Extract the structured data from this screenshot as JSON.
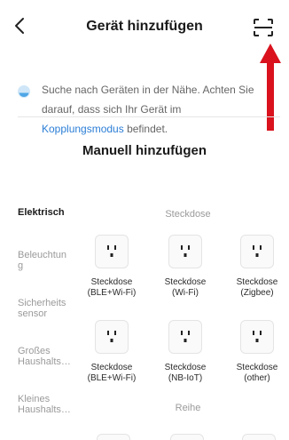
{
  "header": {
    "title": "Gerät hinzufügen"
  },
  "info": {
    "text_before": "Suche nach Geräten in der Nähe. Achten Sie darauf, dass sich Ihr Gerät im ",
    "link": "Kopplungsmodus",
    "text_after": " befindet."
  },
  "section": {
    "title": "Manuell hinzufügen"
  },
  "categories": [
    {
      "label": "Elektrisch",
      "active": true
    },
    {
      "label": "Beleuchtung",
      "active": false
    },
    {
      "label": "Sicherheitssensor",
      "active": false
    },
    {
      "label": "Großes Haushalts…",
      "active": false
    },
    {
      "label": "Kleines Haushalts…",
      "active": false
    }
  ],
  "category_display": {
    "beleuchtung": [
      "Beleuchtun",
      "g"
    ],
    "sicherheit": [
      "Sicherheits",
      "sensor"
    ],
    "gross": [
      "Großes",
      "Haushalts…"
    ],
    "klein": [
      "Kleines",
      "Haushalts…"
    ]
  },
  "groups": {
    "steckdose": "Steckdose",
    "reihe": "Reihe"
  },
  "devices": [
    {
      "line1": "Steckdose",
      "line2": "(BLE+Wi-Fi)"
    },
    {
      "line1": "Steckdose",
      "line2": "(Wi-Fi)"
    },
    {
      "line1": "Steckdose",
      "line2": "(Zigbee)"
    },
    {
      "line1": "Steckdose",
      "line2": "(BLE+Wi-Fi)"
    },
    {
      "line1": "Steckdose",
      "line2": "(NB-IoT)"
    },
    {
      "line1": "Steckdose",
      "line2": "(other)"
    }
  ],
  "colors": {
    "accent": "#2b7ed6",
    "annotation": "#d9121d",
    "search_dot": "#4ea6e6"
  },
  "icons": {
    "back": "chevron-left-icon",
    "scan": "scan-icon",
    "search": "search-pulse-icon",
    "device": "socket-icon"
  }
}
